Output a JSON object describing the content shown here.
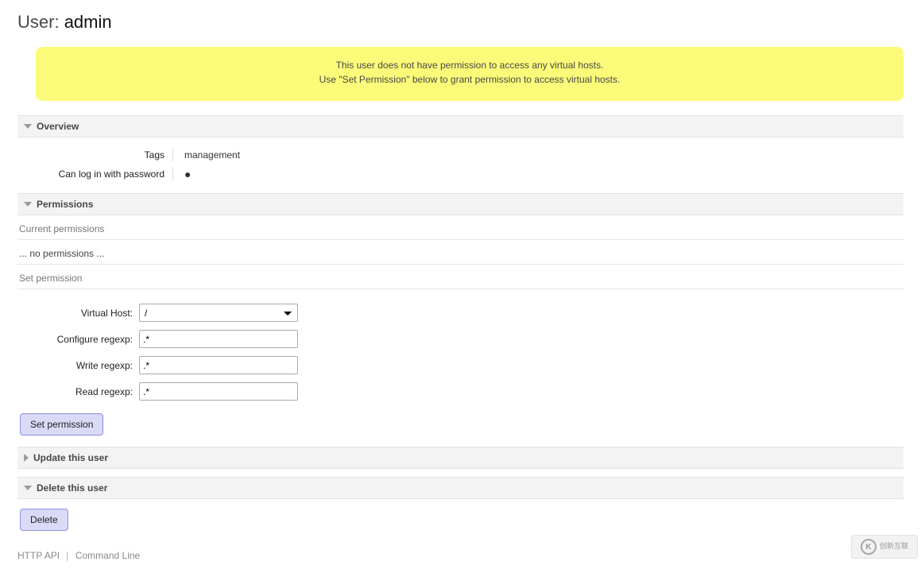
{
  "title": {
    "prefix": "User: ",
    "name": "admin"
  },
  "warning": {
    "line1": "This user does not have permission to access any virtual hosts.",
    "line2": "Use \"Set Permission\" below to grant permission to access virtual hosts."
  },
  "sections": {
    "overview": {
      "header": "Overview",
      "tags_label": "Tags",
      "tags_value": "management",
      "login_label": "Can log in with password",
      "login_value": "●"
    },
    "permissions": {
      "header": "Permissions",
      "current_label": "Current permissions",
      "no_permissions": "... no permissions ...",
      "set_label": "Set permission",
      "form": {
        "vhost_label": "Virtual Host:",
        "vhost_value": "/",
        "configure_label": "Configure regexp:",
        "configure_value": ".*",
        "write_label": "Write regexp:",
        "write_value": ".*",
        "read_label": "Read regexp:",
        "read_value": ".*"
      },
      "submit_label": "Set permission"
    },
    "update": {
      "header": "Update this user"
    },
    "delete": {
      "header": "Delete this user",
      "button": "Delete"
    }
  },
  "footer": {
    "http_api": "HTTP API",
    "cmd_line": "Command Line"
  },
  "watermark": {
    "icon": "K",
    "text": "创新互联"
  }
}
